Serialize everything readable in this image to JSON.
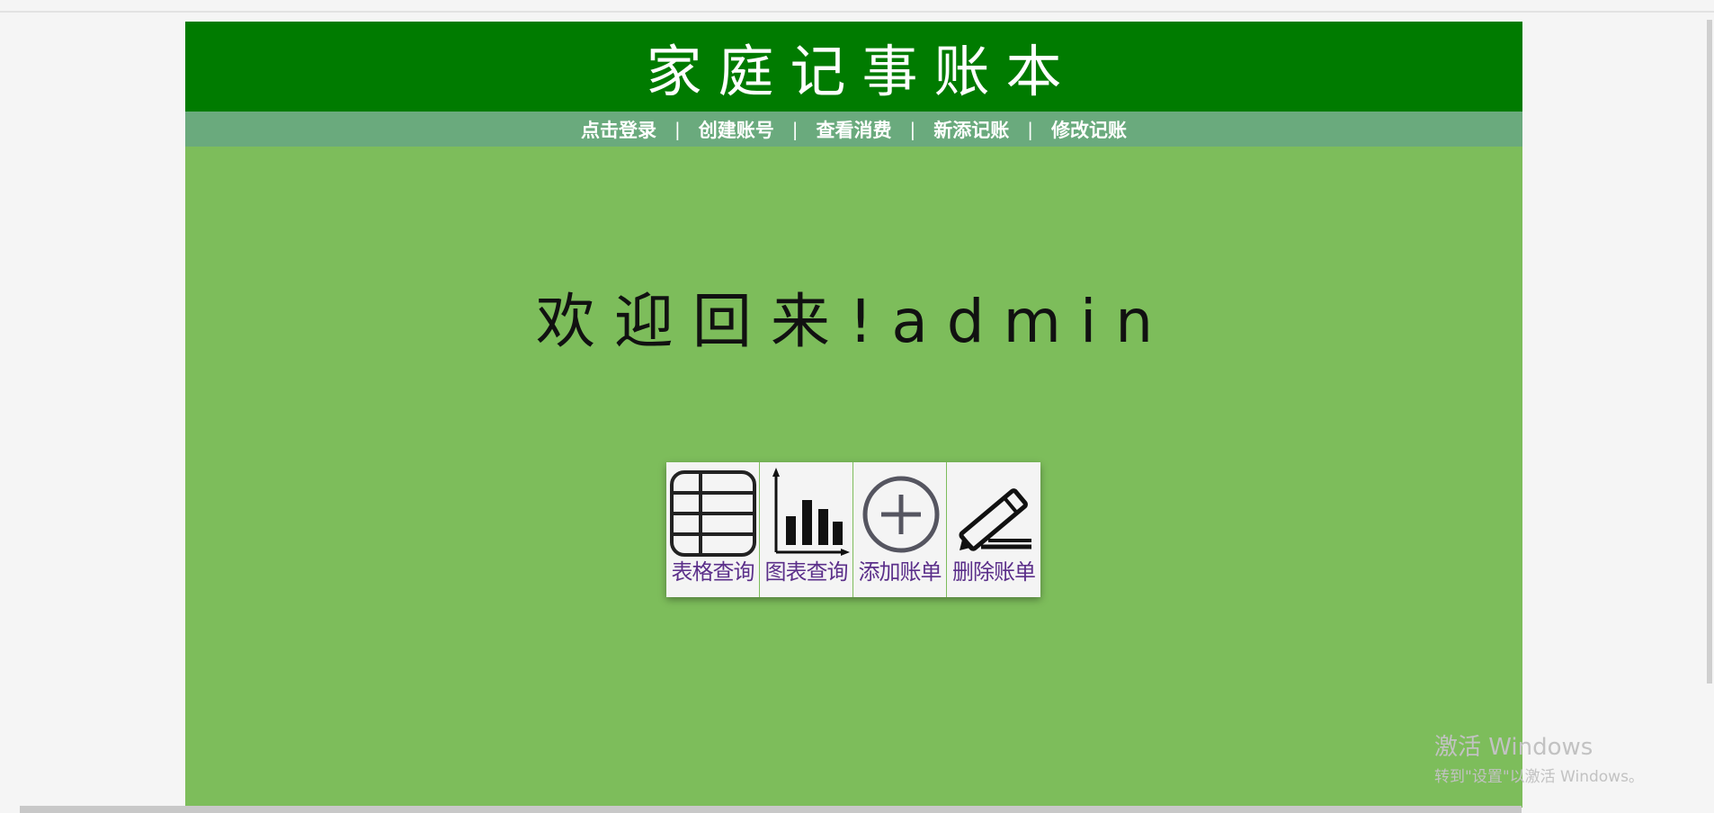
{
  "header": {
    "title": "家庭记事账本"
  },
  "nav": {
    "items": [
      {
        "label": "点击登录"
      },
      {
        "label": "创建账号"
      },
      {
        "label": "查看消费"
      },
      {
        "label": "新添记账"
      },
      {
        "label": "修改记账"
      }
    ],
    "separator": "|"
  },
  "main": {
    "welcome": "欢迎回来!admin",
    "tiles": [
      {
        "label": "表格查询",
        "icon": "table-icon"
      },
      {
        "label": "图表查询",
        "icon": "bar-chart-icon"
      },
      {
        "label": "添加账单",
        "icon": "add-circle-icon"
      },
      {
        "label": "删除账单",
        "icon": "pencil-icon"
      }
    ]
  },
  "watermark": {
    "title": "激活 Windows",
    "subtitle": "转到\"设置\"以激活 Windows。"
  },
  "colors": {
    "header_bg": "#007b00",
    "nav_bg": "#6aaa7d",
    "body_bg": "#7dbd5b",
    "tile_bg": "#f4f4f4",
    "tile_label": "#5b2f8a"
  }
}
